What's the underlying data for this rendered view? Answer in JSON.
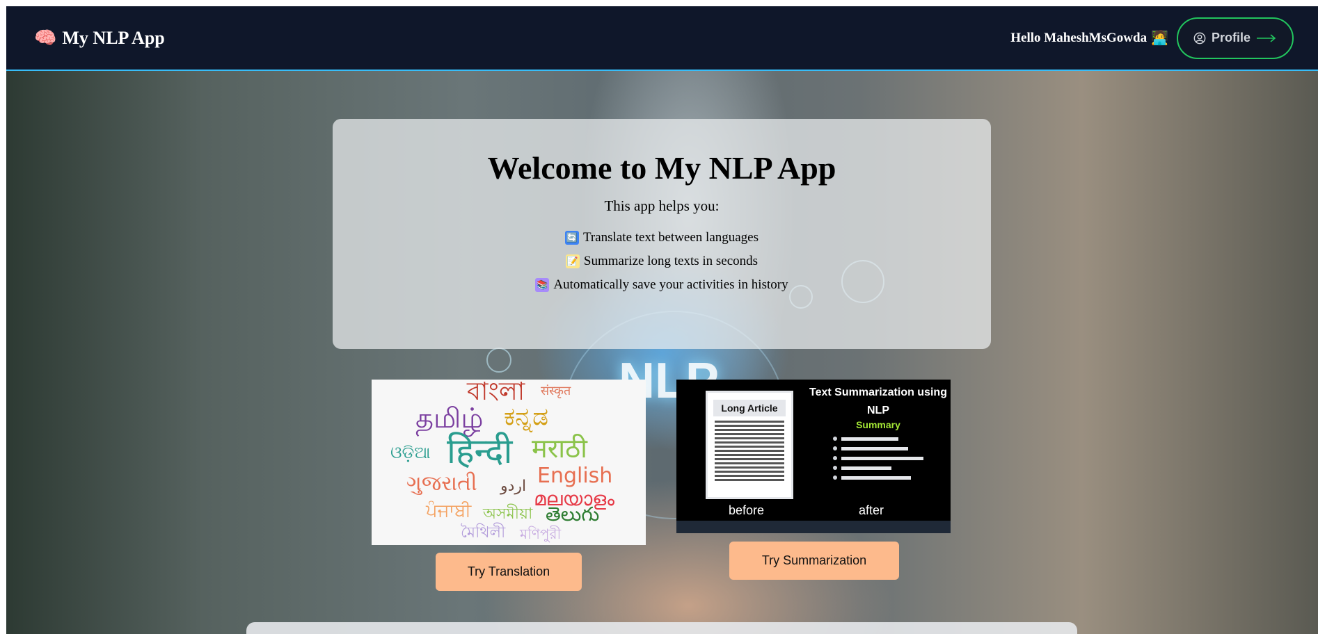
{
  "navbar": {
    "brand_icon": "🧠",
    "brand_title": "My NLP App",
    "greeting": "Hello MaheshMsGowda",
    "greeting_icon": "🧑‍💻",
    "profile_label": "Profile"
  },
  "welcome": {
    "title": "Welcome to My NLP App",
    "subtitle": "This app helps you:",
    "features": [
      {
        "icon": "🔄",
        "text": "Translate text between languages"
      },
      {
        "icon": "📝",
        "text": "Summarize long texts in seconds"
      },
      {
        "icon": "📚",
        "text": "Automatically save your activities in history"
      }
    ]
  },
  "hero_background_text": "NLP",
  "translation_image": {
    "words": [
      "বাংলা",
      "संस्कृत",
      "தமிழ்",
      "ಕನ್ನಡ",
      "ଓଡ଼ିଆ",
      "हिन्दी",
      "मराठी",
      "ગુજરાતી",
      "اردو",
      "English",
      "മലയാളം",
      "ਪੰਜਾਬੀ",
      "অসমীয়া",
      "తెలుగు",
      "মৈথিলী",
      "মণিপুরী"
    ]
  },
  "summary_image": {
    "doc_title": "Long Article",
    "title": "Text Summarization using NLP",
    "summary_label": "Summary",
    "before_caption": "before",
    "after_caption": "after"
  },
  "buttons": {
    "translation": "Try Translation",
    "summarization": "Try Summarization"
  },
  "colors": {
    "navbar_bg": "#0f172a",
    "profile_border": "#22c55e",
    "button_bg": "#fdba8c"
  }
}
